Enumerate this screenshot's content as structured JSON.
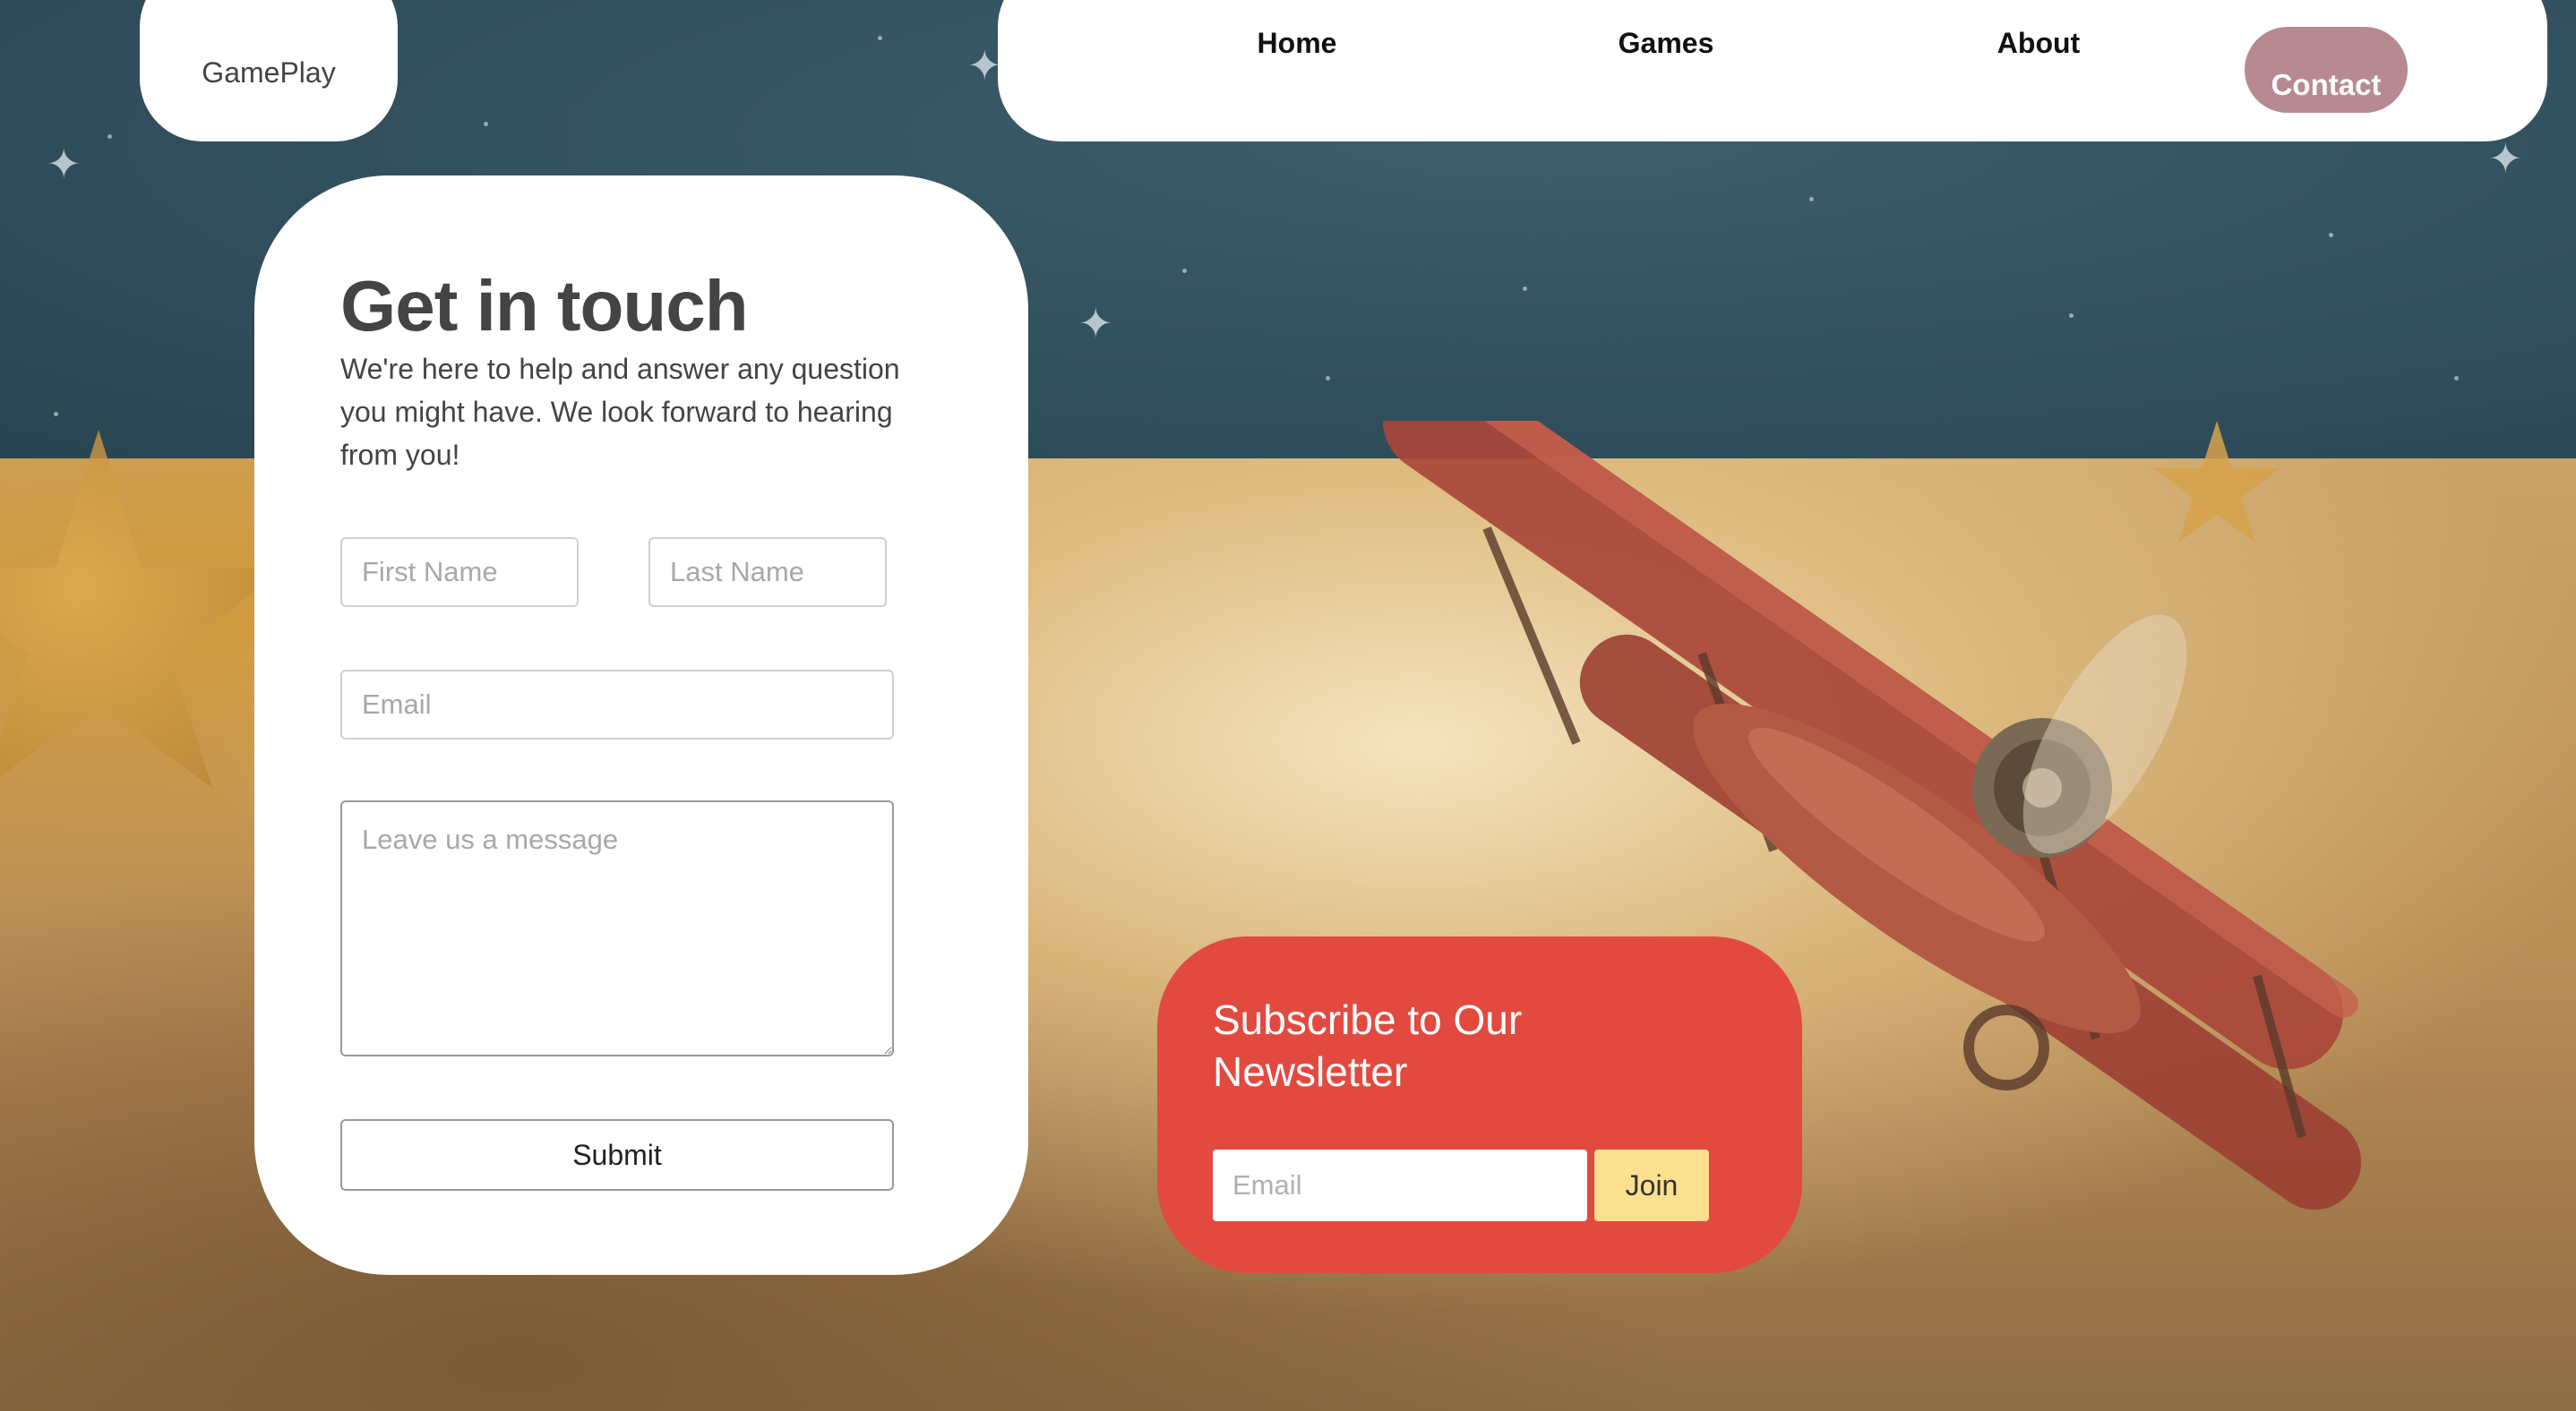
{
  "brand": {
    "name": "GamePlay"
  },
  "nav": {
    "home": "Home",
    "games": "Games",
    "about": "About",
    "contact": "Contact",
    "active": "Contact"
  },
  "contact_form": {
    "title": "Get in touch",
    "description": "We're here to help and answer any question you might have. We look forward to hearing from you!",
    "first_name_placeholder": "First Name",
    "last_name_placeholder": "Last Name",
    "email_placeholder": "Email",
    "message_placeholder": "Leave us a message",
    "submit_label": "Submit"
  },
  "newsletter": {
    "title": "Subscribe to Our Newsletter",
    "email_placeholder": "Email",
    "join_label": "Join"
  },
  "colors": {
    "active_nav": "#b78a91",
    "newsletter_bg": "#e24a40",
    "join_button": "#fbe08e"
  }
}
